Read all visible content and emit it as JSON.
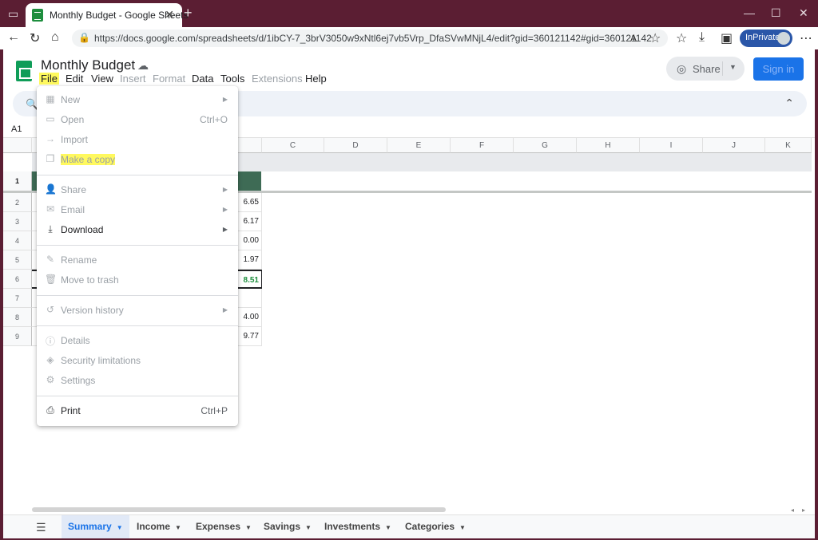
{
  "browser": {
    "tab_title": "Monthly Budget - Google Sheets",
    "url": "https://docs.google.com/spreadsheets/d/1ibCY-7_3brV3050w9xNtl6ej7vb5Vrp_DfaSVwMNjL4/edit?gid=360121142#gid=360121142",
    "inprivate_label": "InPrivate",
    "colors": {
      "frame": "#5b1e33",
      "inprivate": "#2a56a8"
    }
  },
  "app": {
    "doc_title": "Monthly Budget",
    "menus": [
      {
        "label": "File",
        "enabled": true
      },
      {
        "label": "Edit",
        "enabled": true
      },
      {
        "label": "View",
        "enabled": true
      },
      {
        "label": "Insert",
        "enabled": false
      },
      {
        "label": "Format",
        "enabled": false
      },
      {
        "label": "Data",
        "enabled": true
      },
      {
        "label": "Tools",
        "enabled": true
      },
      {
        "label": "Extensions",
        "enabled": false
      },
      {
        "label": "Help",
        "enabled": true
      }
    ],
    "share_label": "Share",
    "signin_label": "Sign in",
    "name_box": "A1",
    "accent": "#1a73e8",
    "header_fill": "#3e6b55"
  },
  "grid": {
    "columns": [
      "C",
      "D",
      "E",
      "F",
      "G",
      "H",
      "I",
      "J",
      "K"
    ],
    "rows": [
      "1",
      "2",
      "3",
      "4",
      "5",
      "6",
      "7",
      "8",
      "9"
    ],
    "b_values": [
      "",
      "6.65",
      "6.17",
      "0.00",
      "1.97",
      "8.51",
      "",
      "4.00",
      "9.77"
    ]
  },
  "file_menu": {
    "items": [
      {
        "label": "New",
        "icon": "new-sheet-icon",
        "enabled": false,
        "submenu": true
      },
      {
        "label": "Open",
        "icon": "folder-icon",
        "enabled": false,
        "shortcut": "Ctrl+O"
      },
      {
        "label": "Import",
        "icon": "import-icon",
        "enabled": false
      },
      {
        "label": "Make a copy",
        "icon": "copy-icon",
        "enabled": false,
        "highlight": true
      },
      {
        "label": "Share",
        "icon": "person-add-icon",
        "enabled": false,
        "submenu": true
      },
      {
        "label": "Email",
        "icon": "email-icon",
        "enabled": false,
        "submenu": true
      },
      {
        "label": "Download",
        "icon": "download-icon",
        "enabled": true,
        "submenu": true
      },
      {
        "label": "Rename",
        "icon": "pencil-icon",
        "enabled": false
      },
      {
        "label": "Move to trash",
        "icon": "trash-icon",
        "enabled": false
      },
      {
        "label": "Version history",
        "icon": "history-icon",
        "enabled": false,
        "submenu": true
      },
      {
        "label": "Details",
        "icon": "info-icon",
        "enabled": false
      },
      {
        "label": "Security limitations",
        "icon": "shield-icon",
        "enabled": false
      },
      {
        "label": "Settings",
        "icon": "gear-icon",
        "enabled": false
      },
      {
        "label": "Print",
        "icon": "printer-icon",
        "enabled": true,
        "shortcut": "Ctrl+P"
      }
    ]
  },
  "sheet_tabs": [
    {
      "label": "Summary",
      "active": true
    },
    {
      "label": "Income",
      "active": false
    },
    {
      "label": "Expenses",
      "active": false
    },
    {
      "label": "Savings",
      "active": false
    },
    {
      "label": "Investments",
      "active": false
    },
    {
      "label": "Categories",
      "active": false
    }
  ]
}
